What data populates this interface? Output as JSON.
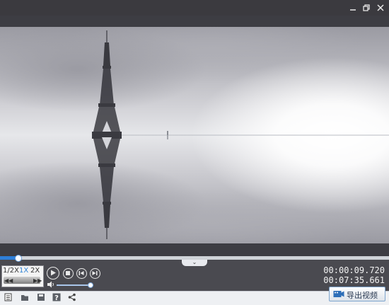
{
  "colors": {
    "accent": "#2e7fd9",
    "chrome": "#3b3a3f",
    "toolbar_bg": "#eef0f3"
  },
  "window_controls": [
    {
      "name": "restore-icon"
    },
    {
      "name": "close-icon"
    }
  ],
  "playback": {
    "progress_fraction": 0.045,
    "volume_fraction": 0.92
  },
  "speed": {
    "options": [
      "1/2X",
      "1X",
      "2X"
    ],
    "selected": "1X"
  },
  "transport": [
    "play-icon",
    "stop-icon",
    "previous-frame-icon",
    "next-frame-icon"
  ],
  "time": {
    "current": "00:00:09.720",
    "total": "00:07:35.661"
  },
  "toolbar": {
    "icons": [
      "new-project-icon",
      "open-folder-icon",
      "save-icon",
      "help-icon",
      "share-icon"
    ],
    "export_label": "导出视频"
  }
}
